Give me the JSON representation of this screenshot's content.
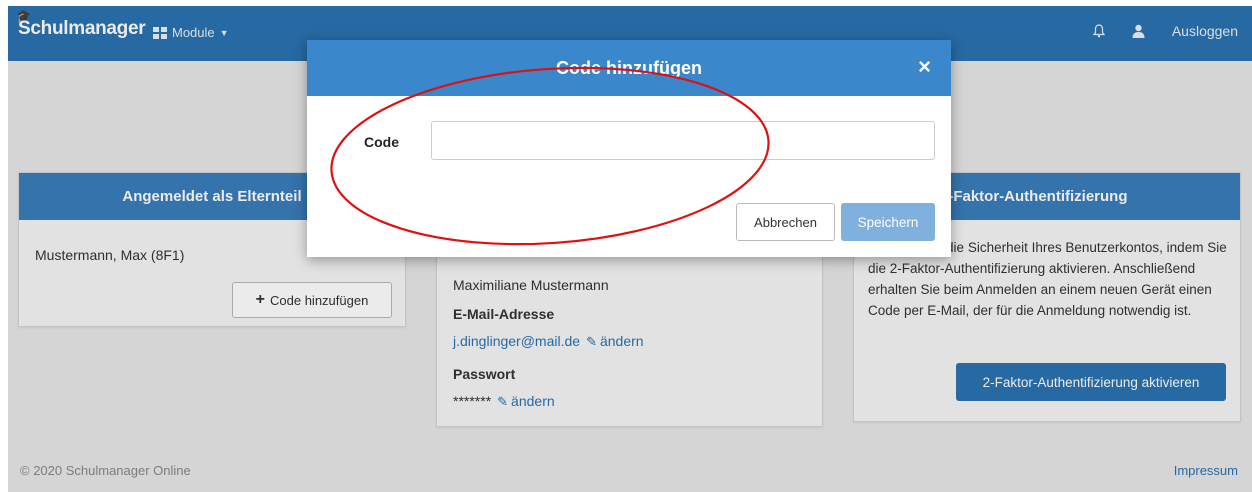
{
  "navbar": {
    "brand": "Schulmanager",
    "modules_label": "Module",
    "logout_label": "Ausloggen"
  },
  "parent_panel": {
    "title": "Angemeldet als Elternteil",
    "child_name": "Mustermann, Max (8F1)",
    "add_code_label": "Code hinzufügen"
  },
  "account_panel": {
    "full_name": "Maximiliane Mustermann",
    "email_label": "E-Mail-Adresse",
    "email_value": "j.dinglinger@mail.de",
    "change_label": "ändern",
    "password_label": "Passwort",
    "password_value": "*******"
  },
  "twofa_panel": {
    "title": "2-Faktor-Authentifizierung",
    "description": "Erhöhen Sie die Sicherheit Ihres Benutzerkontos, indem Sie die 2-Faktor-Authentifizierung aktivieren. Anschließend erhalten Sie beim Anmelden an einem neuen Gerät einen Code per E-Mail, der für die Anmeldung notwendig ist.",
    "activate_label": "2-Faktor-Authentifizierung aktivieren"
  },
  "footer": {
    "copyright": "© 2020 Schulmanager Online",
    "imprint": "Impressum"
  },
  "modal": {
    "title": "Code hinzufügen",
    "close_glyph": "×",
    "code_label": "Code",
    "code_value": "",
    "cancel_label": "Abbrechen",
    "save_label": "Speichern"
  },
  "colors": {
    "primary": "#2b72b0",
    "panel_header": "#3a7dbb",
    "save_disabled": "#7fb0de",
    "annotation": "#e01010"
  },
  "icons": [
    "graduation-cap-icon",
    "grid-icon",
    "caret-down-icon",
    "bell-icon",
    "user-icon",
    "plus-icon",
    "pencil-icon",
    "close-icon"
  ]
}
